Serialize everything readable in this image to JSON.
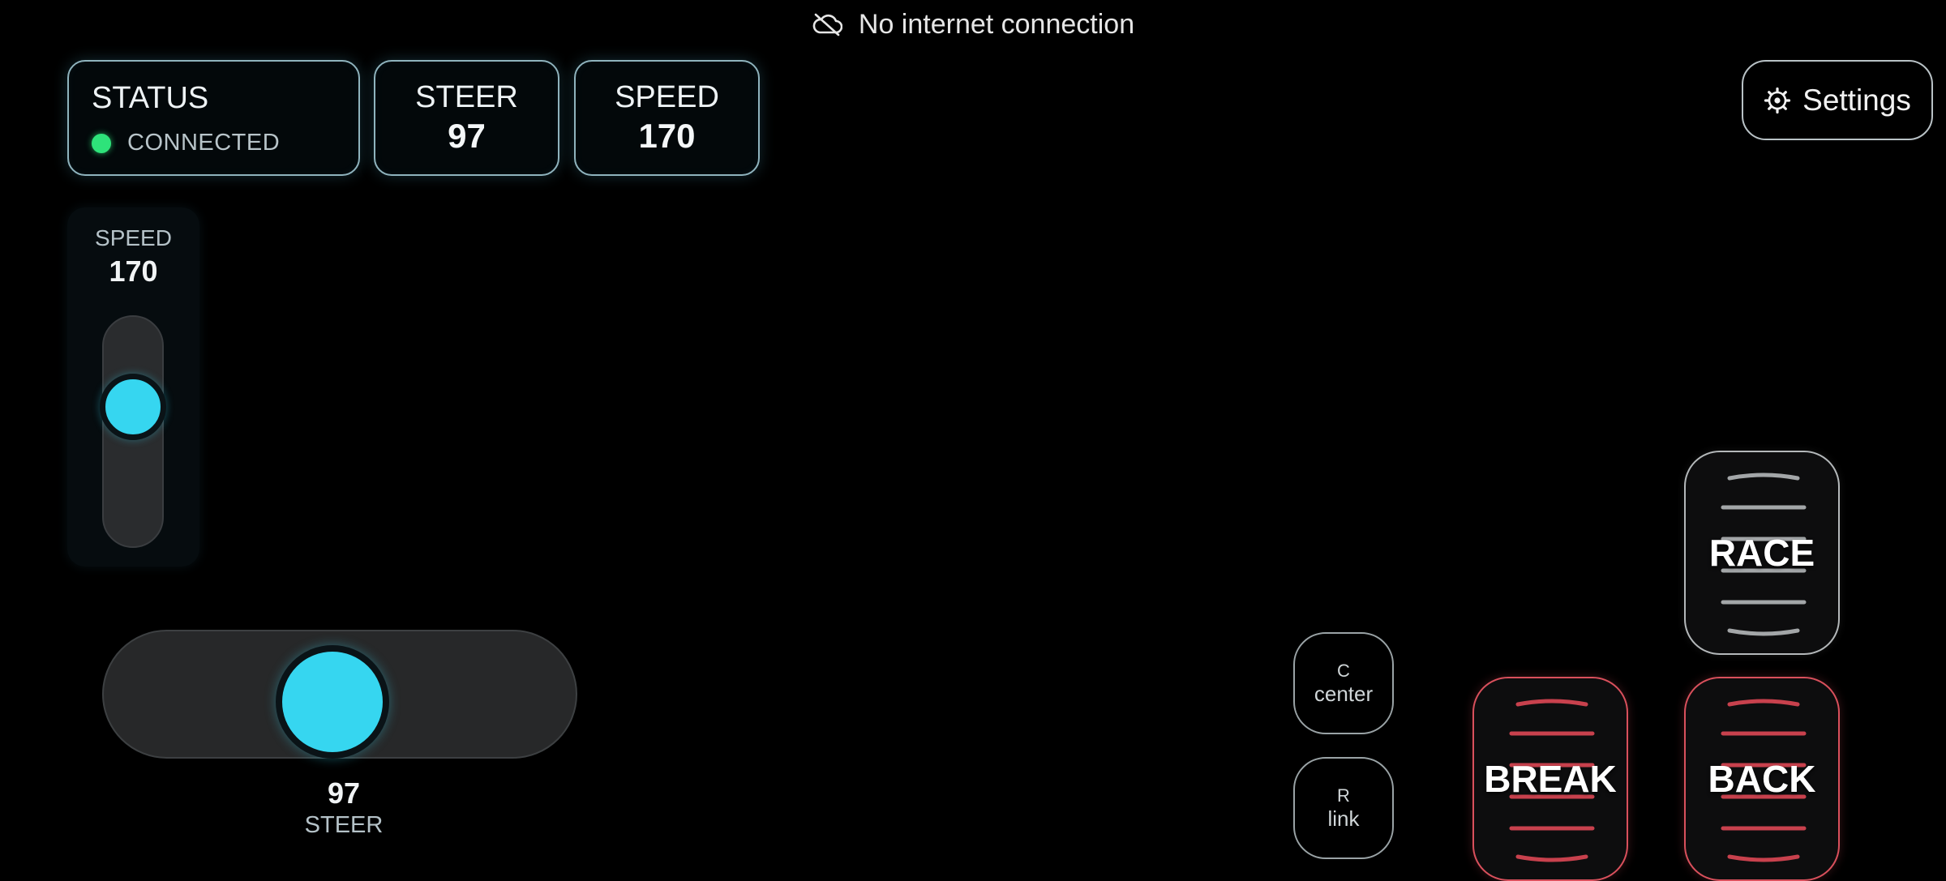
{
  "banner": {
    "icon": "cloud-off-icon",
    "text": "No internet connection"
  },
  "status_card": {
    "title": "STATUS",
    "status_text": "CONNECTED",
    "status_color": "#2ee37a"
  },
  "steer_card": {
    "title": "STEER",
    "value": "97"
  },
  "speed_card": {
    "title": "SPEED",
    "value": "170"
  },
  "settings": {
    "icon": "gear-icon",
    "label": "Settings"
  },
  "speed_slider": {
    "label": "SPEED",
    "value": "170",
    "level_fraction": 0.35
  },
  "steer_slider": {
    "label": "STEER",
    "value": "97",
    "level_fraction": 0.48
  },
  "buttons": {
    "center": {
      "key": "C",
      "label": "center"
    },
    "link": {
      "key": "R",
      "label": "link"
    },
    "race": {
      "label": "RACE"
    },
    "break": {
      "label": "BREAK"
    },
    "back": {
      "label": "BACK"
    }
  },
  "colors": {
    "accent": "#36d6f0",
    "card_border": "#8fb3bd",
    "danger": "#d9505c",
    "connected": "#2ee37a"
  }
}
